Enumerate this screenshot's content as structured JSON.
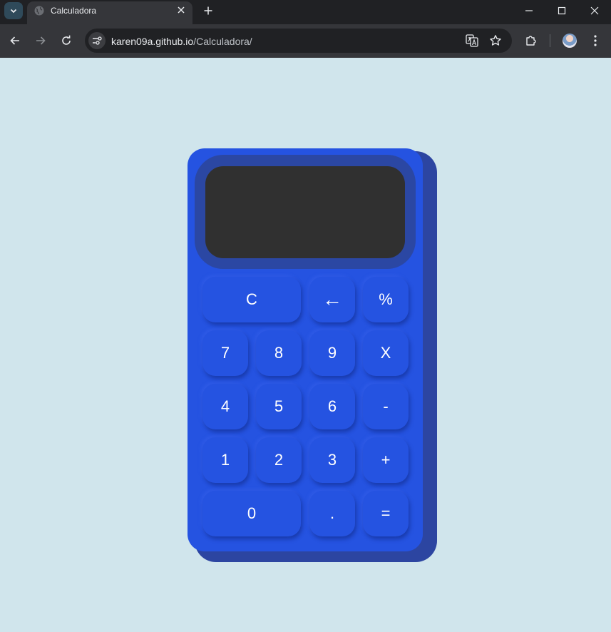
{
  "browser": {
    "tab_title": "Calculadora",
    "url_host": "karen09a.github.io",
    "url_path": "/Calculadora/"
  },
  "calculator": {
    "display": "",
    "keys": {
      "clear": "C",
      "backspace": "←",
      "percent": "%",
      "seven": "7",
      "eight": "8",
      "nine": "9",
      "multiply": "X",
      "four": "4",
      "five": "5",
      "six": "6",
      "minus": "-",
      "one": "1",
      "two": "2",
      "three": "3",
      "plus": "+",
      "zero": "0",
      "decimal": ".",
      "equals": "="
    }
  },
  "colors": {
    "page_background": "#d0e5ec",
    "calculator_body": "#2553e1",
    "calculator_shadow": "#2c45a1",
    "screen": "#303030",
    "key_text": "#ffffff"
  }
}
